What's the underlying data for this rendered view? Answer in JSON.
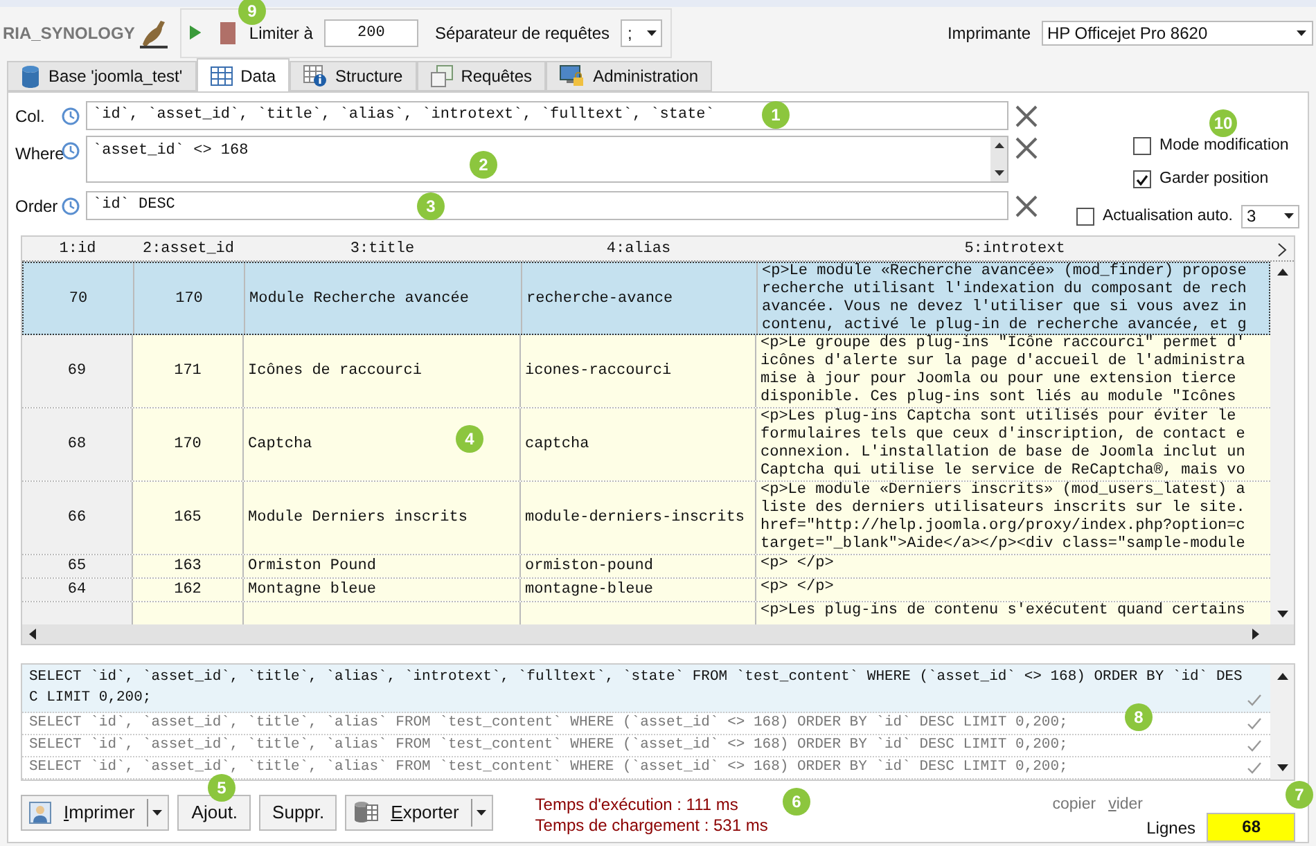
{
  "server": {
    "name": "RIA_SYNOLOGY"
  },
  "toolbar": {
    "limit_label": "Limiter à",
    "limit_value": "200",
    "separator_label": "Séparateur de requêtes",
    "separator_value": ";",
    "printer_label": "Imprimante",
    "printer_value": "HP Officejet Pro 8620"
  },
  "tabs": [
    {
      "label": "Base 'joomla_test'",
      "selected": false
    },
    {
      "label": "Data",
      "selected": true
    },
    {
      "label": "Structure",
      "selected": false
    },
    {
      "label": "Requêtes",
      "selected": false
    },
    {
      "label": "Administration",
      "selected": false
    }
  ],
  "filters": [
    {
      "label": "Col.",
      "value": "`id`, `asset_id`, `title`, `alias`, `introtext`, `fulltext`, `state`",
      "kind": "line"
    },
    {
      "label": "Where",
      "value": "`asset_id` <> 168",
      "kind": "multiline"
    },
    {
      "label": "Order",
      "value": "`id` DESC",
      "kind": "line"
    }
  ],
  "options": {
    "checkboxes": [
      {
        "label": "Mode modification",
        "checked": false
      },
      {
        "label": "Garder position",
        "checked": true
      }
    ],
    "auto_refresh": {
      "label": "Actualisation auto.",
      "checked": false,
      "value": "3"
    }
  },
  "table": {
    "columns": [
      "1:id",
      "2:asset_id",
      "3:title",
      "4:alias",
      "5:introtext"
    ],
    "rows": [
      {
        "selected": true,
        "cells": [
          "70",
          "170",
          "Module Recherche avancée",
          "recherche-avance",
          [
            "<p>Le module «Recherche avancée» (mod_finder) propose",
            "recherche utilisant l'indexation du composant de rech",
            "avancée. Vous ne devez l'utiliser que si vous avez in",
            "contenu, activé le plug-in de recherche avancée, et g"
          ]
        ]
      },
      {
        "selected": false,
        "cells": [
          "69",
          "171",
          "Icônes de raccourci",
          "icones-raccourci",
          [
            "<p>Le groupe des plug-ins \"Icône raccourci\" permet d'",
            "icônes d'alerte sur la page d'accueil de l'administra",
            "mise à jour pour Joomla ou pour une extension tierce",
            "disponible. Ces plug-ins sont liés au module \"Icônes"
          ]
        ]
      },
      {
        "selected": false,
        "cells": [
          "68",
          "170",
          "Captcha",
          "captcha",
          [
            "<p>Les plug-ins Captcha sont utilisés pour éviter le",
            "formulaires tels que ceux d'inscription, de contact e",
            "connexion. L'installation de base de Joomla inclut un",
            "Captcha qui utilise le service de ReCaptcha®, mais vo"
          ]
        ]
      },
      {
        "selected": false,
        "cells": [
          "66",
          "165",
          "Module Derniers inscrits",
          "module-derniers-inscrits",
          [
            "<p>Le module «Derniers inscrits» (mod_users_latest) a",
            "liste des derniers utilisateurs inscrits sur le site.",
            "href=\"http://help.joomla.org/proxy/index.php?option=c",
            "target=\"_blank\">Aide</a></p><div class=\"sample-module"
          ]
        ]
      },
      {
        "selected": false,
        "cells": [
          "65",
          "163",
          "Ormiston Pound",
          "ormiston-pound",
          [
            "<p> </p>"
          ]
        ]
      },
      {
        "selected": false,
        "cells": [
          "64",
          "162",
          "Montagne bleue",
          "montagne-bleue",
          [
            "<p> </p>"
          ]
        ]
      },
      {
        "selected": false,
        "cells": [
          "",
          "",
          "",
          "",
          [
            "<p>Les plug-ins de contenu s'exécutent quand certains"
          ]
        ]
      }
    ]
  },
  "log": {
    "entries": [
      {
        "text": "SELECT `id`, `asset_id`, `title`, `alias`, `introtext`, `fulltext`, `state` FROM `test_content` WHERE (`asset_id` <> 168) ORDER BY `id` DESC LIMIT 0,200;",
        "selected": true
      },
      {
        "text": "SELECT `id`, `asset_id`, `title`, `alias` FROM `test_content` WHERE (`asset_id` <> 168) ORDER BY `id` DESC LIMIT 0,200;",
        "selected": false
      },
      {
        "text": "SELECT `id`, `asset_id`, `title`, `alias` FROM `test_content` WHERE (`asset_id` <> 168) ORDER BY `id` DESC LIMIT 0,200;",
        "selected": false
      },
      {
        "text": "SELECT `id`, `asset_id`, `title`, `alias` FROM `test_content` WHERE (`asset_id` <> 168) ORDER BY `id` DESC LIMIT 0,200;",
        "selected": false
      }
    ],
    "actions": [
      {
        "label": "copier",
        "underline": false
      },
      {
        "label": "vider",
        "underline": true
      }
    ]
  },
  "buttons": [
    {
      "label": "Imprimer",
      "menu": true,
      "underline": true
    },
    {
      "label": "Ajout.",
      "menu": false,
      "underline": false
    },
    {
      "label": "Suppr.",
      "menu": false,
      "underline": false
    },
    {
      "label": "Exporter",
      "menu": true,
      "underline": true
    }
  ],
  "timings": [
    "Temps d'exécution : 111 ms",
    "Temps de chargement : 531 ms"
  ],
  "row_count": {
    "label": "Lignes",
    "value": "68"
  },
  "callouts": [
    "1",
    "2",
    "3",
    "4",
    "5",
    "6",
    "7",
    "8",
    "9",
    "10"
  ]
}
